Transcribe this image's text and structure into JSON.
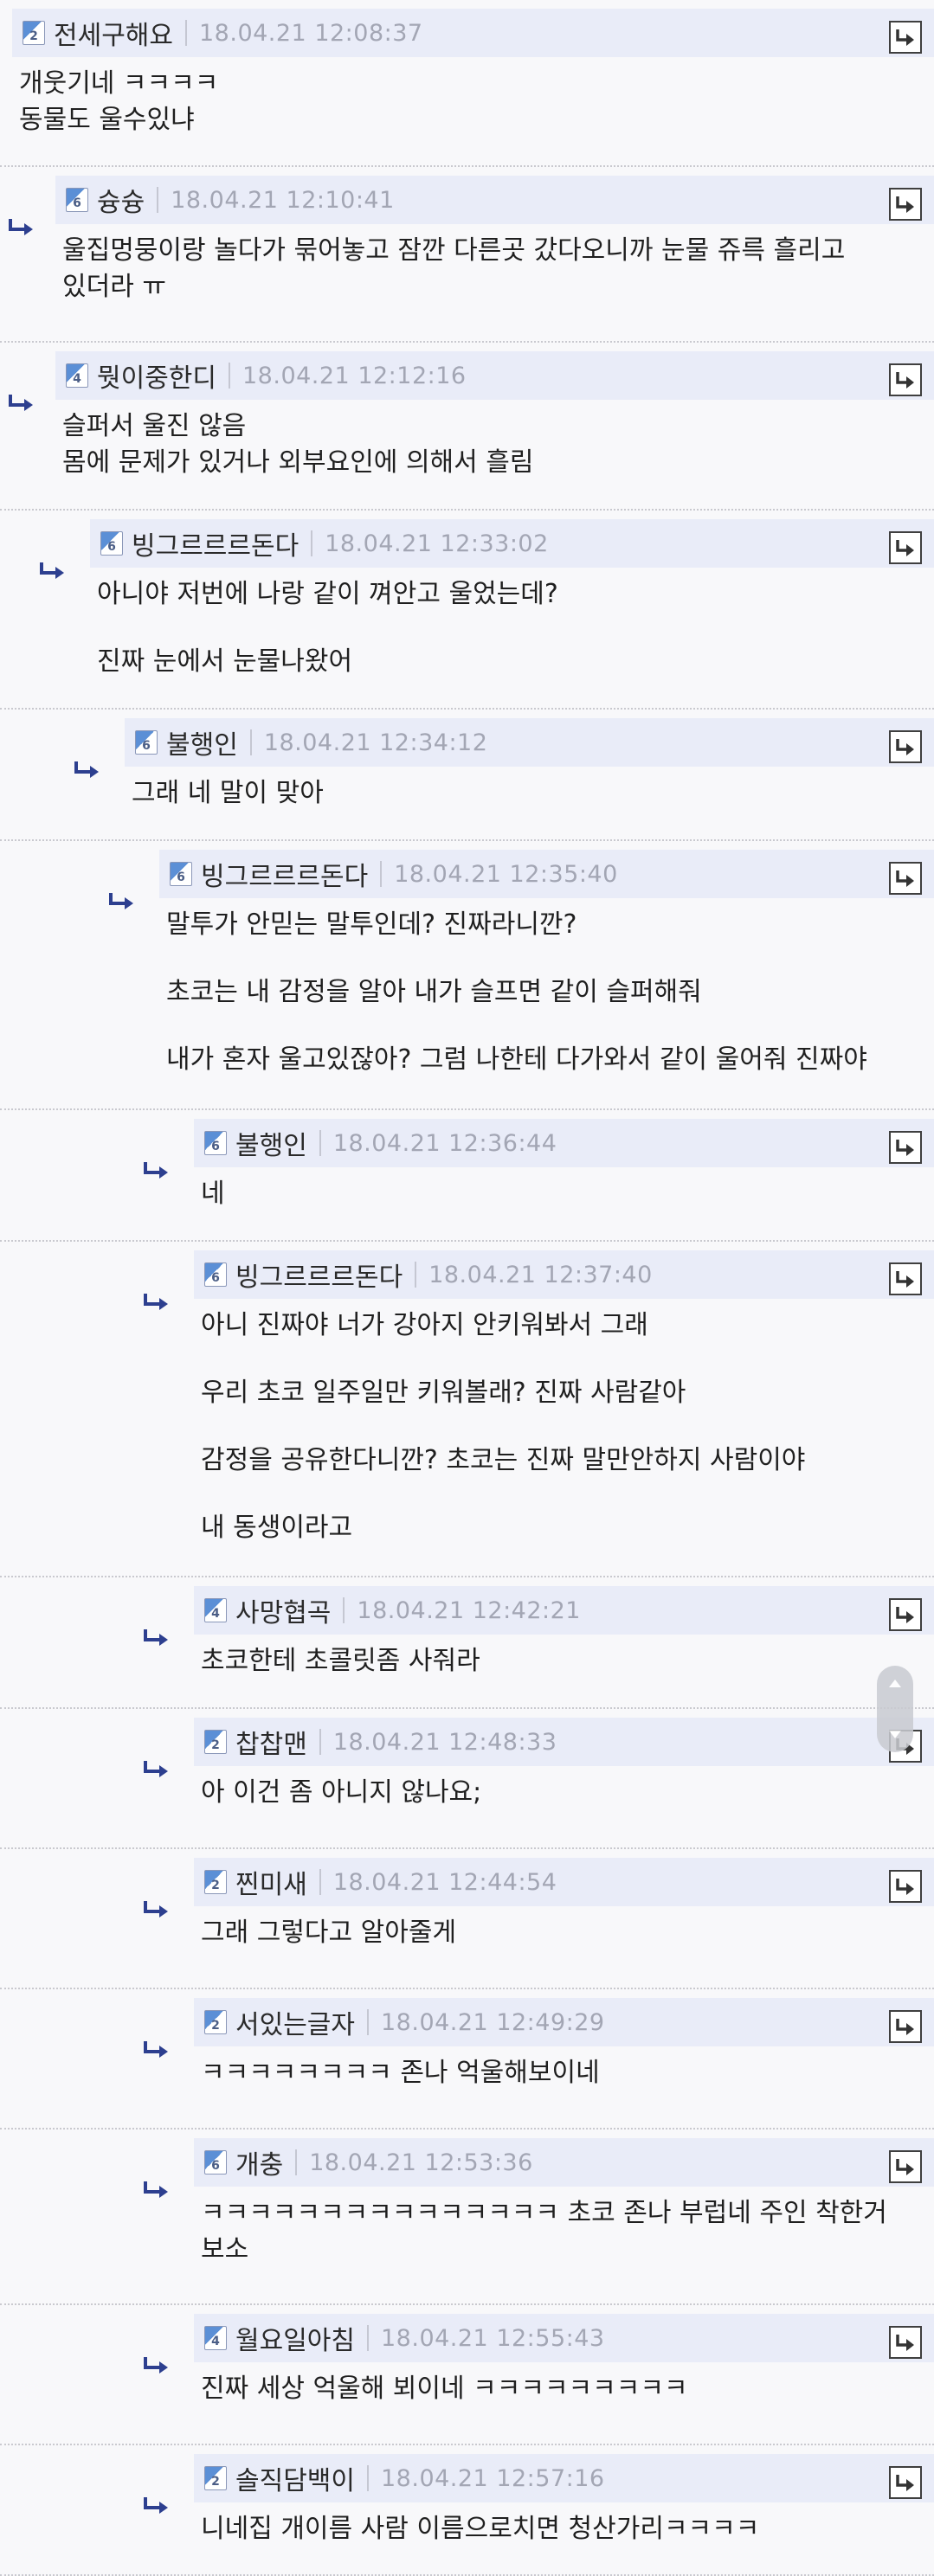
{
  "comments": [
    {
      "nick": "전세구해요",
      "level": "2",
      "date": "18.04.21 12:08:37",
      "lines": [
        "개웃기네 ㅋㅋㅋㅋ\n동물도 울수있냐"
      ]
    },
    {
      "nick": "슝슝",
      "level": "6",
      "date": "18.04.21 12:10:41",
      "lines": [
        "울집멍뭉이랑 놀다가 묶어놓고 잠깐 다른곳 갔다오니까 눈물 쥬륵 흘리고\n있더라 ㅠ"
      ]
    },
    {
      "nick": "뭣이중한디",
      "level": "4",
      "date": "18.04.21 12:12:16",
      "lines": [
        "슬퍼서 울진 않음\n몸에 문제가 있거나 외부요인에 의해서 흘림"
      ]
    },
    {
      "nick": "빙그르르르돈다",
      "level": "6",
      "date": "18.04.21 12:33:02",
      "lines": [
        "아니야 저번에 나랑 같이 껴안고 울었는데?",
        "진짜 눈에서 눈물나왔어"
      ]
    },
    {
      "nick": "불행인",
      "level": "6",
      "date": "18.04.21 12:34:12",
      "lines": [
        "그래 네 말이 맞아"
      ]
    },
    {
      "nick": "빙그르르르돈다",
      "level": "6",
      "date": "18.04.21 12:35:40",
      "lines": [
        "말투가 안믿는 말투인데? 진짜라니깐?",
        "초코는 내 감정을 알아 내가 슬프면 같이 슬퍼해줘",
        "내가 혼자 울고있잖아? 그럼 나한테 다가와서 같이 울어줘 진짜야"
      ]
    },
    {
      "nick": "불행인",
      "level": "6",
      "date": "18.04.21 12:36:44",
      "lines": [
        "네"
      ]
    },
    {
      "nick": "빙그르르르돈다",
      "level": "6",
      "date": "18.04.21 12:37:40",
      "lines": [
        "아니 진짜야 너가 강아지 안키워봐서 그래",
        "우리 초코 일주일만 키워볼래? 진짜 사람같아",
        "감정을 공유한다니깐? 초코는 진짜 말만안하지 사람이야",
        "내 동생이라고"
      ]
    },
    {
      "nick": "사망협곡",
      "level": "4",
      "date": "18.04.21 12:42:21",
      "lines": [
        "초코한테 초콜릿좀 사줘라"
      ]
    },
    {
      "nick": "찹찹맨",
      "level": "2",
      "date": "18.04.21 12:48:33",
      "lines": [
        "아 이건 좀 아니지 않나요;"
      ]
    },
    {
      "nick": "찐미새",
      "level": "2",
      "date": "18.04.21 12:44:54",
      "lines": [
        "그래 그렇다고 알아줄게"
      ]
    },
    {
      "nick": "서있는글자",
      "level": "2",
      "date": "18.04.21 12:49:29",
      "lines": [
        "ㅋㅋㅋㅋㅋㅋㅋㅋ 존나 억울해보이네"
      ]
    },
    {
      "nick": "개충",
      "level": "6",
      "date": "18.04.21 12:53:36",
      "lines": [
        "ㅋㅋㅋㅋㅋㅋㅋㅋㅋㅋㅋㅋㅋㅋㅋ 초코 존나 부럽네 주인 착한거\n보소"
      ]
    },
    {
      "nick": "월요일아침",
      "level": "4",
      "date": "18.04.21 12:55:43",
      "lines": [
        "진짜 세상 억울해 뵈이네 ㅋㅋㅋㅋㅋㅋㅋㅋㅋ"
      ]
    },
    {
      "nick": "솔직담백이",
      "level": "2",
      "date": "18.04.21 12:57:16",
      "lines": [
        "니네집 개이름 사람 이름으로치면 청산가리ㅋㅋㅋㅋ"
      ]
    }
  ]
}
